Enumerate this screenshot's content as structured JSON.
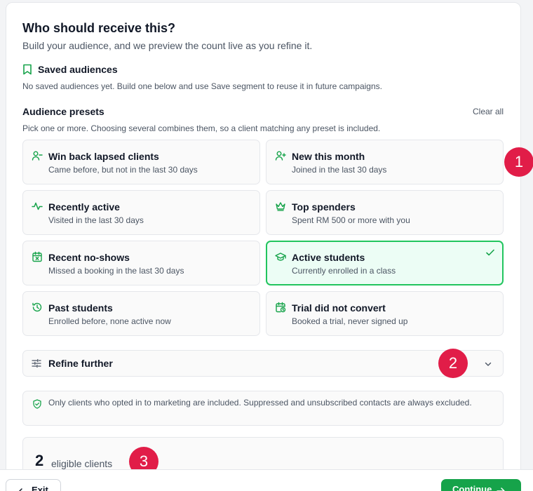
{
  "header": {
    "title": "Who should receive this?",
    "subtitle": "Build your audience, and we preview the count live as you refine it."
  },
  "saved": {
    "title": "Saved audiences",
    "description": "No saved audiences yet. Build one below and use Save segment to reuse it in future campaigns."
  },
  "presets": {
    "title": "Audience presets",
    "clear_label": "Clear all",
    "description": "Pick one or more. Choosing several combines them, so a client matching any preset is included.",
    "items": [
      {
        "title": "Win back lapsed clients",
        "subtitle": "Came before, but not in the last 30 days",
        "icon": "user-minus-icon",
        "selected": false
      },
      {
        "title": "New this month",
        "subtitle": "Joined in the last 30 days",
        "icon": "user-plus-icon",
        "selected": false
      },
      {
        "title": "Recently active",
        "subtitle": "Visited in the last 30 days",
        "icon": "activity-icon",
        "selected": false
      },
      {
        "title": "Top spenders",
        "subtitle": "Spent RM 500 or more with you",
        "icon": "crown-icon",
        "selected": false
      },
      {
        "title": "Recent no-shows",
        "subtitle": "Missed a booking in the last 30 days",
        "icon": "calendar-x-icon",
        "selected": false
      },
      {
        "title": "Active students",
        "subtitle": "Currently enrolled in a class",
        "icon": "graduation-cap-icon",
        "selected": true
      },
      {
        "title": "Past students",
        "subtitle": "Enrolled before, none active now",
        "icon": "history-icon",
        "selected": false
      },
      {
        "title": "Trial did not convert",
        "subtitle": "Booked a trial, never signed up",
        "icon": "calendar-clock-icon",
        "selected": false
      }
    ]
  },
  "refine": {
    "label": "Refine further"
  },
  "notice": {
    "text": "Only clients who opted in to marketing are included. Suppressed and unsubscribed contacts are always excluded."
  },
  "count": {
    "value": "2",
    "label": "eligible clients"
  },
  "badges": [
    "1",
    "2",
    "3"
  ],
  "footer": {
    "exit_label": "Exit",
    "continue_label": "Continue"
  },
  "colors": {
    "accent": "#16a34a",
    "selected_bg": "#ecfdf5",
    "selected_border": "#22c55e",
    "badge": "#e11d48"
  }
}
